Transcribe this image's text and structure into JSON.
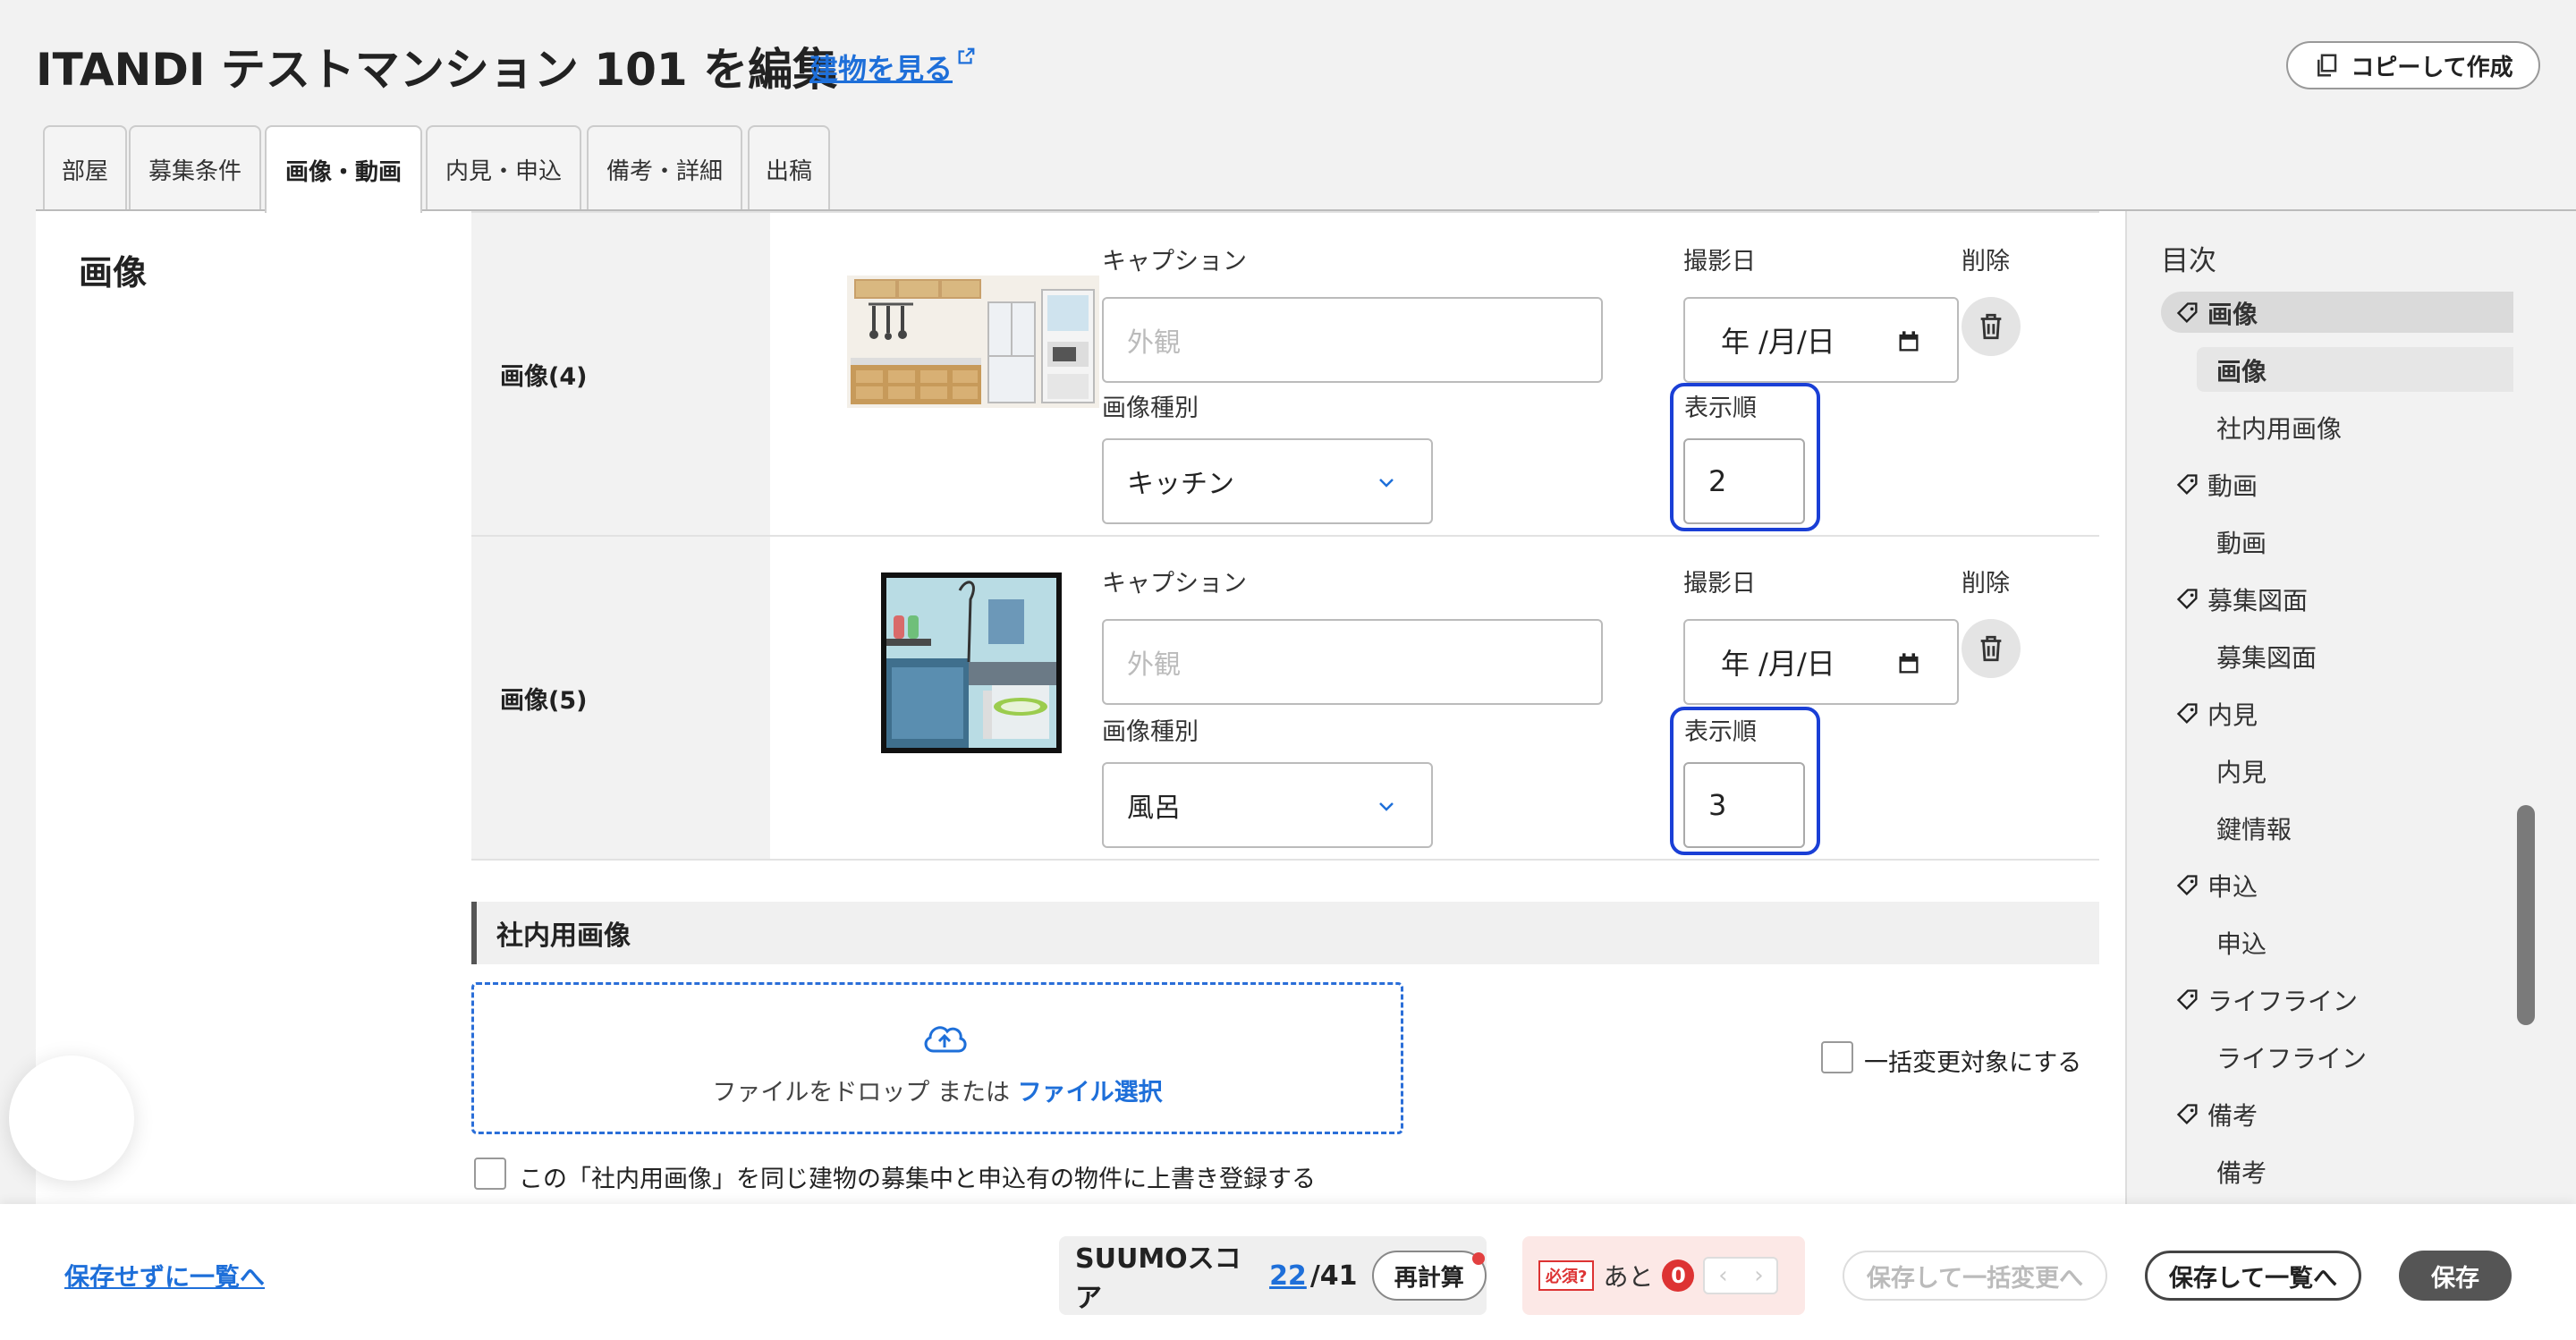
{
  "header": {
    "title": "ITANDI テストマンション 101 を編集",
    "building_link": "建物を見る",
    "copy_button": "コピーして作成"
  },
  "tabs": [
    {
      "label": "部屋"
    },
    {
      "label": "募集条件"
    },
    {
      "label": "画像・動画",
      "active": true
    },
    {
      "label": "内見・申込"
    },
    {
      "label": "備考・詳細"
    },
    {
      "label": "出稿"
    }
  ],
  "section": {
    "title": "画像"
  },
  "fields": {
    "caption_label": "キャプション",
    "date_label": "撮影日",
    "delete_label": "削除",
    "type_label": "画像種別",
    "order_label": "表示順",
    "caption_placeholder": "外観",
    "date_value": "年 /月/日"
  },
  "images": [
    {
      "label": "画像(4)",
      "type": "キッチン",
      "order": "2"
    },
    {
      "label": "画像(5)",
      "type": "風呂",
      "order": "3"
    }
  ],
  "internal": {
    "title": "社内用画像",
    "drop_text": "ファイルをドロップ または ",
    "select_link": "ファイル選択",
    "bulk_checkbox": "一括変更対象にする",
    "overwrite_checkbox": "この「社内用画像」を同じ建物の募集中と申込有の物件に上書き登録する"
  },
  "toc": {
    "title": "目次",
    "items": [
      {
        "label": "画像",
        "level": 1
      },
      {
        "label": "画像",
        "level": 2
      },
      {
        "label": "社内用画像",
        "level": 2
      },
      {
        "label": "動画",
        "level": 1
      },
      {
        "label": "動画",
        "level": 2
      },
      {
        "label": "募集図面",
        "level": 1
      },
      {
        "label": "募集図面",
        "level": 2
      },
      {
        "label": "内見",
        "level": 1
      },
      {
        "label": "内見",
        "level": 2
      },
      {
        "label": "鍵情報",
        "level": 2
      },
      {
        "label": "申込",
        "level": 1
      },
      {
        "label": "申込",
        "level": 2
      },
      {
        "label": "ライフライン",
        "level": 1
      },
      {
        "label": "ライフライン",
        "level": 2
      },
      {
        "label": "備考",
        "level": 1
      },
      {
        "label": "備考",
        "level": 2
      }
    ]
  },
  "footer": {
    "back_link": "保存せずに一覧へ",
    "score_label": "SUUMOスコア",
    "score_value": "22",
    "score_total": "/41",
    "recalc": "再計算",
    "required_badge": "必須?",
    "remaining_label": "あと",
    "remaining_count": "0",
    "save_bulk": "保存して一括変更へ",
    "save_list": "保存して一覧へ",
    "save": "保存"
  },
  "colors": {
    "accent": "#1e6fd9",
    "focus": "#1a3fd6",
    "primary_button": "#555555",
    "required": "#d33333"
  }
}
